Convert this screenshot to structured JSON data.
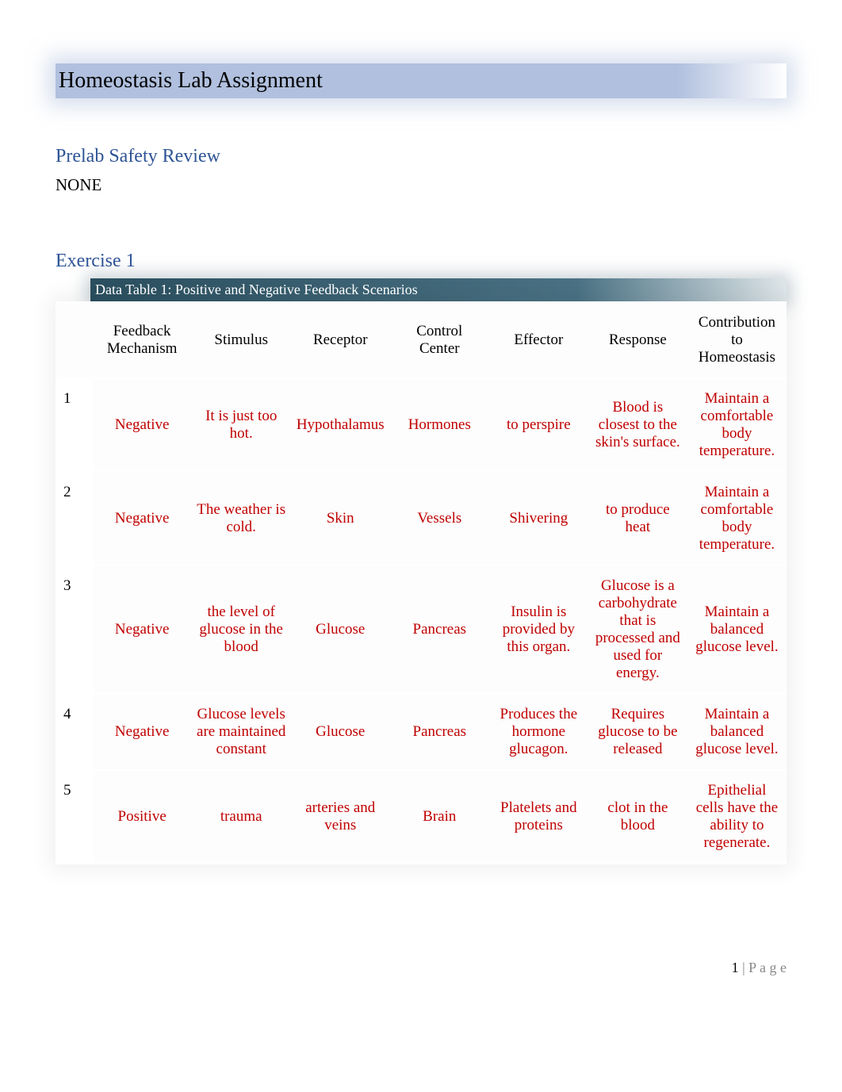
{
  "title": "Homeostasis Lab Assignment",
  "prelab": {
    "heading": "Prelab Safety Review",
    "content": "NONE"
  },
  "exercise": {
    "heading": "Exercise 1"
  },
  "table": {
    "caption": "Data Table 1: Positive and Negative Feedback Scenarios",
    "headers": [
      "Feedback Mechanism",
      "Stimulus",
      "Receptor",
      "Control Center",
      "Effector",
      "Response",
      "Contribution to Homeostasis"
    ],
    "rows": [
      {
        "n": "1",
        "feedback": "Negative",
        "stimulus": "It is just too hot.",
        "receptor": "Hypothalamus",
        "control": "Hormones",
        "effector": "to perspire",
        "response": "Blood is closest to the skin's surface.",
        "contribution": "Maintain a comfortable body temperature."
      },
      {
        "n": "2",
        "feedback": "Negative",
        "stimulus": "The weather is cold.",
        "receptor": "Skin",
        "control": "Vessels",
        "effector": "Shivering",
        "response": "to produce heat",
        "contribution": "Maintain a comfortable body temperature."
      },
      {
        "n": "3",
        "feedback": "Negative",
        "stimulus": "the level of glucose in the blood",
        "receptor": "Glucose",
        "control": "Pancreas",
        "effector": "Insulin is provided by this organ.",
        "response": "Glucose is a carbohydrate that is processed and used for energy.",
        "contribution": "Maintain a balanced glucose level."
      },
      {
        "n": "4",
        "feedback": "Negative",
        "stimulus": "Glucose levels are maintained constant",
        "receptor": "Glucose",
        "control": "Pancreas",
        "effector": "Produces the hormone glucagon.",
        "response": "Requires glucose to be released",
        "contribution": "Maintain a balanced glucose level."
      },
      {
        "n": "5",
        "feedback": "Positive",
        "stimulus": "trauma",
        "receptor": "arteries and veins",
        "control": "Brain",
        "effector": "Platelets and proteins",
        "response": "clot in the blood",
        "contribution": "Epithelial cells have the ability to regenerate."
      }
    ]
  },
  "footer": {
    "page_number": "1",
    "page_label": "P a g e"
  }
}
